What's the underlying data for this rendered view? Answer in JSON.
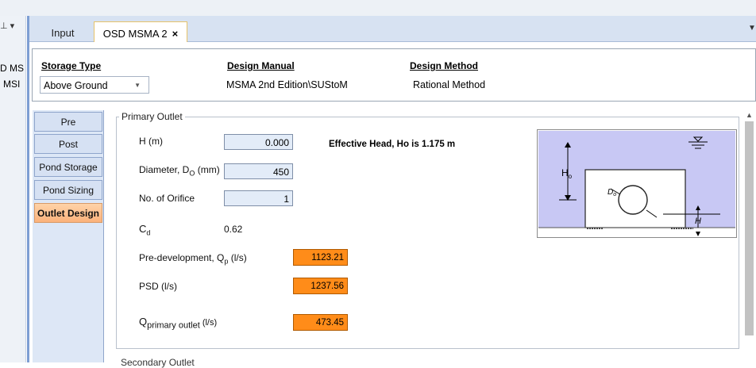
{
  "left_panel": {
    "cut_text_1": "D MS",
    "cut_text_2": "MSI"
  },
  "doc_tabs": [
    {
      "label": "Input"
    },
    {
      "label": "OSD MSMA 2"
    }
  ],
  "close_glyph": "×",
  "info": {
    "storage_type": {
      "header": "Storage Type",
      "value": "Above Ground"
    },
    "design_manual": {
      "header": "Design Manual",
      "value": "MSMA 2nd Edition\\SUStoM"
    },
    "design_method": {
      "header": "Design Method",
      "value": "Rational Method"
    }
  },
  "side_tabs": [
    "Pre",
    "Post",
    "Pond Storage",
    "Pond Sizing",
    "Outlet Design"
  ],
  "active_side_tab": "Outlet Design",
  "primary_outlet": {
    "title": "Primary Outlet",
    "h_label": "H (m)",
    "h_value": "0.000",
    "effective_head": "Effective Head, Ho is 1.175 m",
    "diameter_label_main": "Diameter, D",
    "diameter_label_sub": "O",
    "diameter_label_unit": " (mm)",
    "diameter_value": "450",
    "orifice_label": "No. of Orifice",
    "orifice_value": "1",
    "cd_label_main": "C",
    "cd_label_sub": "d",
    "cd_value": "0.62",
    "predev_label_main": "Pre-development, Q",
    "predev_label_sub": "p",
    "predev_label_unit": " (l/s)",
    "predev_value": "1123.21",
    "psd_label": "PSD (l/s)",
    "psd_value": "1237.56",
    "qprimary_label_main": "Q",
    "qprimary_label_sub": "primary outlet",
    "qprimary_label_unit": " (l/s)",
    "qprimary_value": "473.45"
  },
  "diagram": {
    "ho_label": "H",
    "ho_sub": "o",
    "do_label": "D",
    "do_sub": "o",
    "h_label": "H"
  },
  "secondary_outlet_title": "Secondary Outlet",
  "colors": {
    "accent_orange": "#ff8c19",
    "tab_active": "#fbb27b",
    "diagram_water": "#c8c8f4"
  }
}
